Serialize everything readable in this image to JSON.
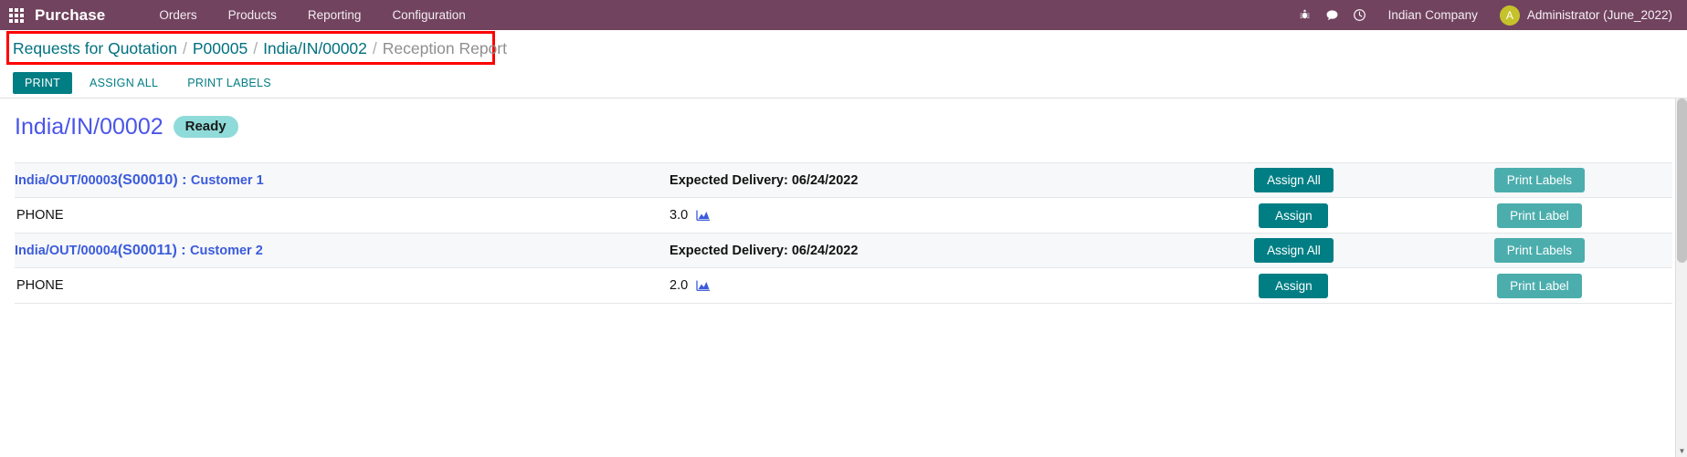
{
  "navbar": {
    "apps_icon": "apps-grid-icon",
    "brand": "Purchase",
    "menu": [
      {
        "label": "Orders"
      },
      {
        "label": "Products"
      },
      {
        "label": "Reporting"
      },
      {
        "label": "Configuration"
      }
    ],
    "icons": [
      {
        "name": "bug-icon"
      },
      {
        "name": "chat-bubble-icon"
      },
      {
        "name": "clock-icon"
      }
    ],
    "company": "Indian Company",
    "user_initial": "A",
    "user": "Administrator (June_2022)",
    "bg_color": "#71435f",
    "avatar_color": "#c5c22b"
  },
  "breadcrumb": {
    "items": [
      {
        "label": "Requests for Quotation",
        "current": false
      },
      {
        "label": "P00005",
        "current": false
      },
      {
        "label": "India/IN/00002",
        "current": false
      },
      {
        "label": "Reception Report",
        "current": true
      }
    ],
    "separator": "/",
    "highlight_color": "#ff0000",
    "link_color": "#00707f"
  },
  "actionbar": {
    "print": "PRINT",
    "assign_all": "ASSIGN ALL",
    "print_labels": "PRINT LABELS",
    "primary_color": "#017e84"
  },
  "document": {
    "title": "India/IN/00002",
    "status_badge": "Ready",
    "title_color": "#4a55e8",
    "badge_color": "#8fdbd9"
  },
  "table": {
    "groups": [
      {
        "source_ref": "India/OUT/00003",
        "source_order": "(S00010)",
        "separator": " : ",
        "customer": "Customer 1",
        "delivery": "Expected Delivery: 06/24/2022",
        "assign_all_label": "Assign All",
        "print_labels_label": "Print Labels",
        "lines": [
          {
            "product": "PHONE",
            "quantity": "3.0",
            "forecast_icon": "forecast-chart-icon",
            "assign_label": "Assign",
            "print_label": "Print Label"
          }
        ]
      },
      {
        "source_ref": "India/OUT/00004",
        "source_order": "(S00011)",
        "separator": " : ",
        "customer": "Customer 2",
        "delivery": "Expected Delivery: 06/24/2022",
        "assign_all_label": "Assign All",
        "print_labels_label": "Print Labels",
        "lines": [
          {
            "product": "PHONE",
            "quantity": "2.0",
            "forecast_icon": "forecast-chart-icon",
            "assign_label": "Assign",
            "print_label": "Print Label"
          }
        ]
      }
    ],
    "assign_color": "#017e84",
    "print_color": "#4cadad",
    "link_color": "#3b5bdb"
  },
  "scrollbar": {
    "up_arrow": "▲",
    "down_arrow": "▼"
  }
}
